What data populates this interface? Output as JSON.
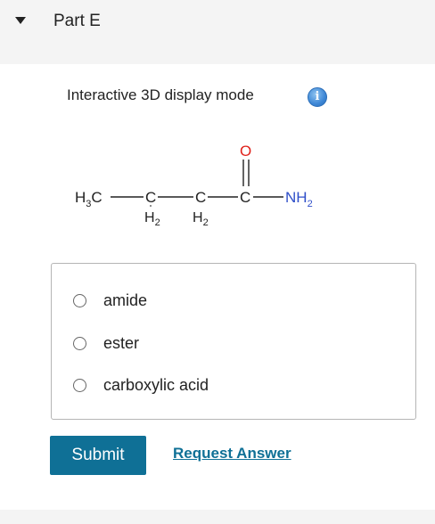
{
  "part": {
    "title": "Part E"
  },
  "display_mode": {
    "label": "Interactive 3D display mode",
    "info_icon_glyph": "i",
    "info_icon": "info-icon"
  },
  "molecule": {
    "h3c": "H",
    "h3c_sub": "3",
    "h3c_c": "C",
    "c1": "C",
    "c1_h": "H",
    "c1_h_sub": "2",
    "c2": "C",
    "c2_h": "H",
    "c2_h_sub": "2",
    "c3": "C",
    "o": "O",
    "nh": "NH",
    "nh_sub": "2",
    "oxygen_color": "#e0211a",
    "nitrogen_color": "#2f4fc9"
  },
  "choices": [
    {
      "label": "amide"
    },
    {
      "label": "ester"
    },
    {
      "label": "carboxylic acid"
    }
  ],
  "actions": {
    "submit_label": "Submit",
    "request_label": "Request Answer"
  },
  "colors": {
    "accent": "#0f7096",
    "header_bg": "#f4f4f4"
  }
}
